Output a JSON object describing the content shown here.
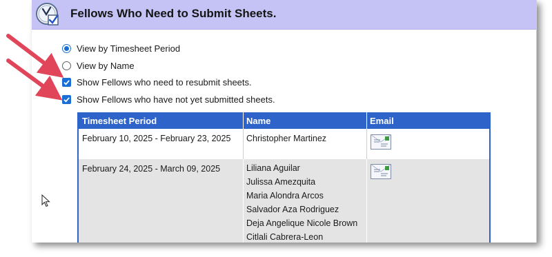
{
  "header": {
    "title": "Fellows Who Need to Submit Sheets."
  },
  "options": [
    {
      "type": "radio",
      "label": "View by Timesheet Period",
      "checked": true
    },
    {
      "type": "radio",
      "label": "View by Name",
      "checked": false
    },
    {
      "type": "checkbox",
      "label": "Show Fellows who need to resubmit sheets.",
      "checked": true
    },
    {
      "type": "checkbox",
      "label": "Show Fellows who have not yet submitted sheets.",
      "checked": true
    }
  ],
  "table": {
    "columns": [
      "Timesheet Period",
      "Name",
      "Email"
    ],
    "rows": [
      {
        "period": "February 10, 2025 - February 23, 2025",
        "names": [
          "Christopher Martinez"
        ]
      },
      {
        "period": "February 24, 2025 - March 09, 2025",
        "names": [
          "Liliana Aguilar",
          "Julissa Amezquita",
          "Maria Alondra Arcos",
          "Salvador Aza Rodriguez",
          "Deja Angelique Nicole Brown",
          "Citlali Cabrera-Leon"
        ]
      }
    ]
  },
  "colors": {
    "header_bg": "#c5c3f6",
    "table_header_bg": "#2e63c9",
    "accent": "#1a6fd6",
    "arrow": "#e0455a"
  },
  "icons": [
    "timesheet-clock-icon",
    "envelope-icon",
    "mouse-pointer-icon"
  ]
}
